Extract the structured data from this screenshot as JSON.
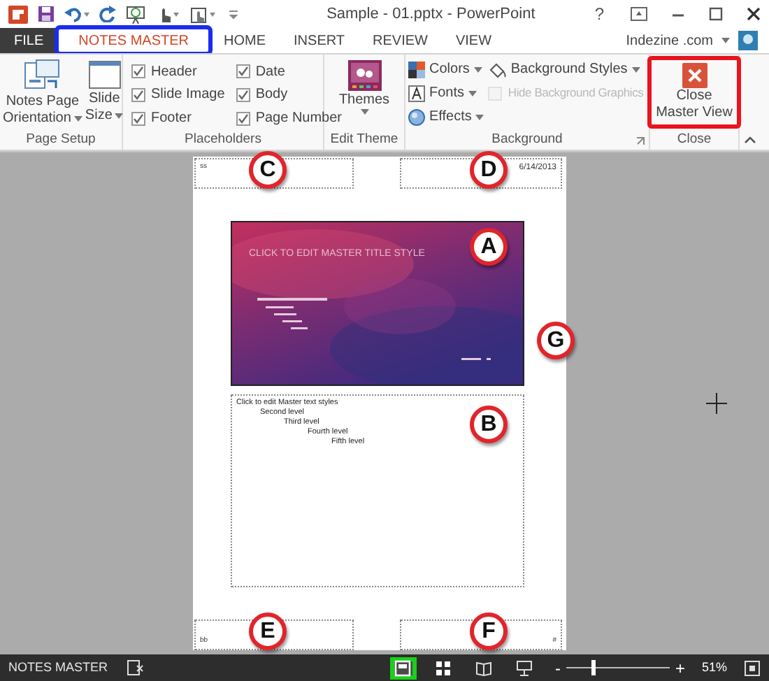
{
  "window": {
    "title": "Sample - 01.pptx - PowerPoint",
    "help": "?"
  },
  "account": {
    "name": "Indezine .com"
  },
  "tabs": [
    {
      "label": "FILE",
      "kind": "file",
      "selected": false,
      "highlighted": false
    },
    {
      "label": "NOTES MASTER",
      "kind": "tab",
      "selected": true,
      "highlighted": true
    },
    {
      "label": "HOME",
      "kind": "tab",
      "selected": false,
      "highlighted": false
    },
    {
      "label": "INSERT",
      "kind": "tab",
      "selected": false,
      "highlighted": false
    },
    {
      "label": "REVIEW",
      "kind": "tab",
      "selected": false,
      "highlighted": false
    },
    {
      "label": "VIEW",
      "kind": "tab",
      "selected": false,
      "highlighted": false
    }
  ],
  "ribbon": {
    "page_setup": {
      "label": "Page Setup",
      "buttons": [
        {
          "lines": [
            "Notes Page",
            "Orientation"
          ]
        },
        {
          "lines": [
            "Slide",
            "Size"
          ]
        }
      ]
    },
    "placeholders": {
      "label": "Placeholders",
      "checkboxes": [
        {
          "label": "Header",
          "checked": true
        },
        {
          "label": "Slide Image",
          "checked": true
        },
        {
          "label": "Footer",
          "checked": true
        },
        {
          "label": "Date",
          "checked": true
        },
        {
          "label": "Body",
          "checked": true
        },
        {
          "label": "Page Number",
          "checked": true
        }
      ]
    },
    "edit_theme": {
      "label": "Edit Theme",
      "button": "Themes"
    },
    "background": {
      "label": "Background",
      "menus": [
        {
          "label": "Colors",
          "kind": "colors"
        },
        {
          "label": "Fonts",
          "kind": "fonts"
        },
        {
          "label": "Effects",
          "kind": "effects"
        }
      ],
      "styles": "Background Styles",
      "hide_graphics": {
        "label": "Hide Background Graphics",
        "checked": false,
        "disabled": true
      }
    },
    "close": {
      "label": "Close",
      "button": {
        "lines": [
          "Close",
          "Master View"
        ],
        "highlighted": true
      }
    }
  },
  "notes_page": {
    "header": "ss",
    "date": "6/14/2013",
    "footer": "bb",
    "page_number": "#",
    "slide_title": "CLICK TO EDIT MASTER TITLE STYLE",
    "body": [
      {
        "text": "Click to edit Master text styles",
        "children": [
          {
            "text": "Second level",
            "children": [
              {
                "text": "Third level",
                "children": [
                  {
                    "text": "Fourth level",
                    "children": [
                      {
                        "text": "Fifth level"
                      }
                    ]
                  }
                ]
              }
            ]
          }
        ]
      }
    ]
  },
  "callouts": [
    {
      "letter": "C"
    },
    {
      "letter": "D"
    },
    {
      "letter": "A"
    },
    {
      "letter": "G"
    },
    {
      "letter": "B"
    },
    {
      "letter": "E"
    },
    {
      "letter": "F"
    }
  ],
  "status_bar": {
    "mode": "NOTES MASTER",
    "views": [
      {
        "kind": "notes",
        "selected": true,
        "highlighted": true
      },
      {
        "kind": "sorter",
        "selected": false,
        "highlighted": false
      },
      {
        "kind": "reading",
        "selected": false,
        "highlighted": false
      },
      {
        "kind": "show",
        "selected": false,
        "highlighted": false
      }
    ],
    "zoom_out": "-",
    "zoom_in": "+",
    "zoom": {
      "level": 0.27
    },
    "zoom_percent": "51%"
  }
}
